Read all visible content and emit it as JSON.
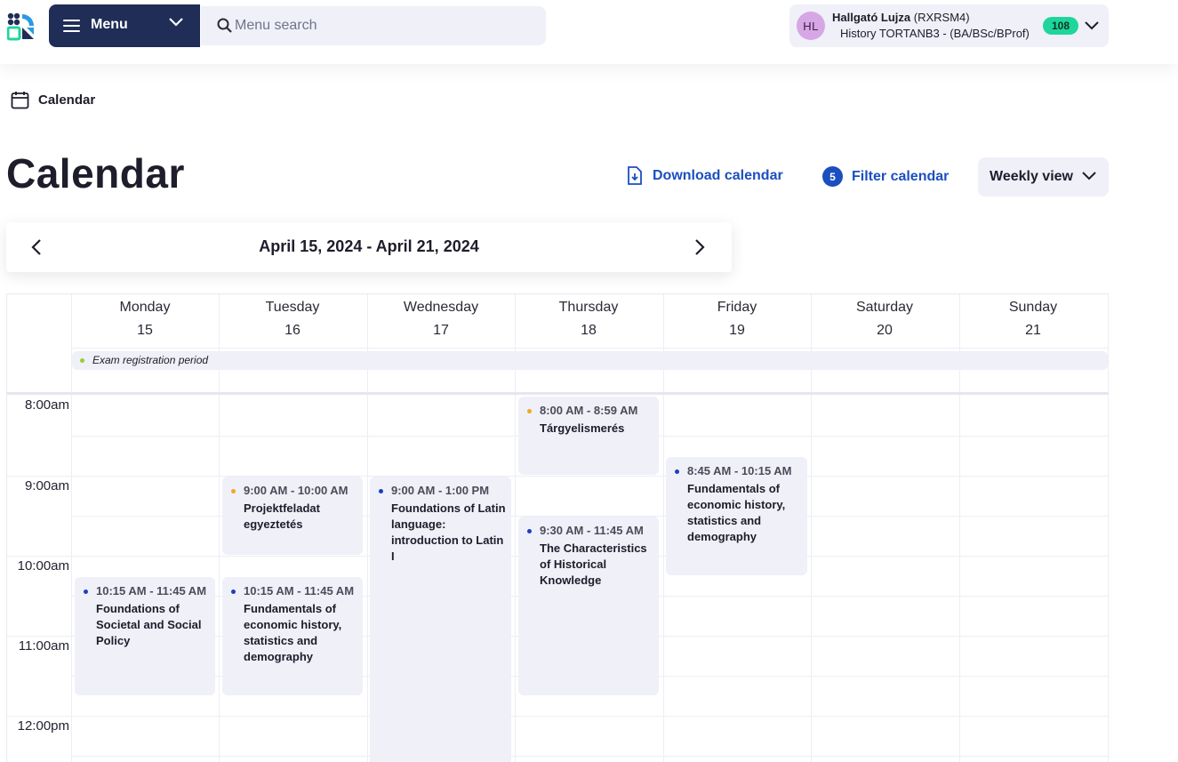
{
  "topbar": {
    "menu_label": "Menu",
    "search_placeholder": "Menu search",
    "user": {
      "initials": "HL",
      "name": "Hallgató Lujza",
      "code": "(RXRSM4)",
      "program": "History TORTANB3 - (BA/BSc/BProf)",
      "count": "108"
    }
  },
  "breadcrumb": {
    "label": "Calendar"
  },
  "page": {
    "title": "Calendar"
  },
  "actions": {
    "download": "Download calendar",
    "filter_count": "5",
    "filter": "Filter calendar",
    "view": "Weekly view"
  },
  "datenav": {
    "range": "April 15, 2024 - April 21, 2024"
  },
  "calendar": {
    "days": [
      {
        "name": "Monday",
        "num": "15"
      },
      {
        "name": "Tuesday",
        "num": "16"
      },
      {
        "name": "Wednesday",
        "num": "17"
      },
      {
        "name": "Thursday",
        "num": "18"
      },
      {
        "name": "Friday",
        "num": "19"
      },
      {
        "name": "Saturday",
        "num": "20"
      },
      {
        "name": "Sunday",
        "num": "21"
      }
    ],
    "allday": {
      "label": "Exam registration period",
      "color": "#9acd32"
    },
    "times": [
      "8:00am",
      "9:00am",
      "10:00am",
      "11:00am",
      "12:00pm"
    ],
    "events": [
      {
        "time": "8:00 AM - 8:59 AM",
        "title": "Tárgyelismerés",
        "color": "#f5a623"
      },
      {
        "time": "9:00 AM - 10:00 AM",
        "title": "Projektfeladat egyeztetés",
        "color": "#f5a623"
      },
      {
        "time": "9:00 AM - 1:00 PM",
        "title": "Foundations of Latin language: introduction to Latin I",
        "color": "#1b3fbf"
      },
      {
        "time": "8:45 AM - 10:15 AM",
        "title": "Fundamentals of economic history, statistics and demography",
        "color": "#1b3fbf"
      },
      {
        "time": "9:30 AM - 11:45 AM",
        "title": "The Characteristics of Historical Knowledge",
        "color": "#1b3fbf"
      },
      {
        "time": "10:15 AM - 11:45 AM",
        "title": "Foundations of Societal and Social Policy",
        "color": "#1b3fbf"
      },
      {
        "time": "10:15 AM - 11:45 AM",
        "title": "Fundamentals of economic history, statistics and demography",
        "color": "#1b3fbf"
      }
    ]
  }
}
